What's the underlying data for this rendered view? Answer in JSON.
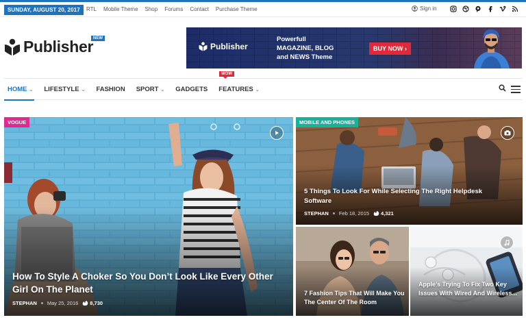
{
  "topbar": {
    "date": "SUNDAY, AUGUST 20, 2017",
    "links": [
      "RTL",
      "Mobile Theme",
      "Shop",
      "Forums",
      "Contact",
      "Purchase Theme"
    ],
    "signin": "Sign in",
    "social_icons": [
      "instagram-icon",
      "dribbble-icon",
      "pinterest-icon",
      "facebook-icon",
      "vimeo-icon",
      "rss-icon"
    ]
  },
  "brand": {
    "name": "Publisher",
    "new_badge": "NEW",
    "accent": "#1e73be"
  },
  "banner": {
    "brand": "Publisher",
    "line1": "Powerfull",
    "line2": "MAGAZINE, BLOG",
    "line3": "and NEWS Theme",
    "button": "BUY NOW"
  },
  "nav": {
    "items": [
      {
        "label": "HOME",
        "dropdown": true
      },
      {
        "label": "LIFESTYLE",
        "dropdown": true
      },
      {
        "label": "FASHION",
        "dropdown": false
      },
      {
        "label": "SPORT",
        "dropdown": true
      },
      {
        "label": "GADGETS",
        "dropdown": false
      },
      {
        "label": "FEATURES",
        "dropdown": true
      }
    ],
    "wow_badge": "WOW"
  },
  "posts": {
    "main": {
      "category": "VOGUE",
      "category_color": "#e02a8f",
      "title": "How To Style A Choker So You Don’t Look Like Every Other Girl On The Planet",
      "author": "STEPHAN",
      "date": "May 25, 2016",
      "count": "8,730",
      "format": "video-icon"
    },
    "top_right": {
      "category": "MOBILE AND PHONES",
      "category_color": "#1bb09a",
      "title": "5 Things To Look For While Selecting The Right Helpdesk Software",
      "author": "STEPHAN",
      "date": "Feb 18, 2015",
      "count": "4,321",
      "format": "camera-icon"
    },
    "bottom_left": {
      "title": "7 Fashion Tips That Will Make You The Center Of The Room"
    },
    "bottom_right": {
      "title": "Apple’s Trying To Fix Two Key Issues With Wired And Wireless...",
      "format": "music-icon"
    }
  }
}
